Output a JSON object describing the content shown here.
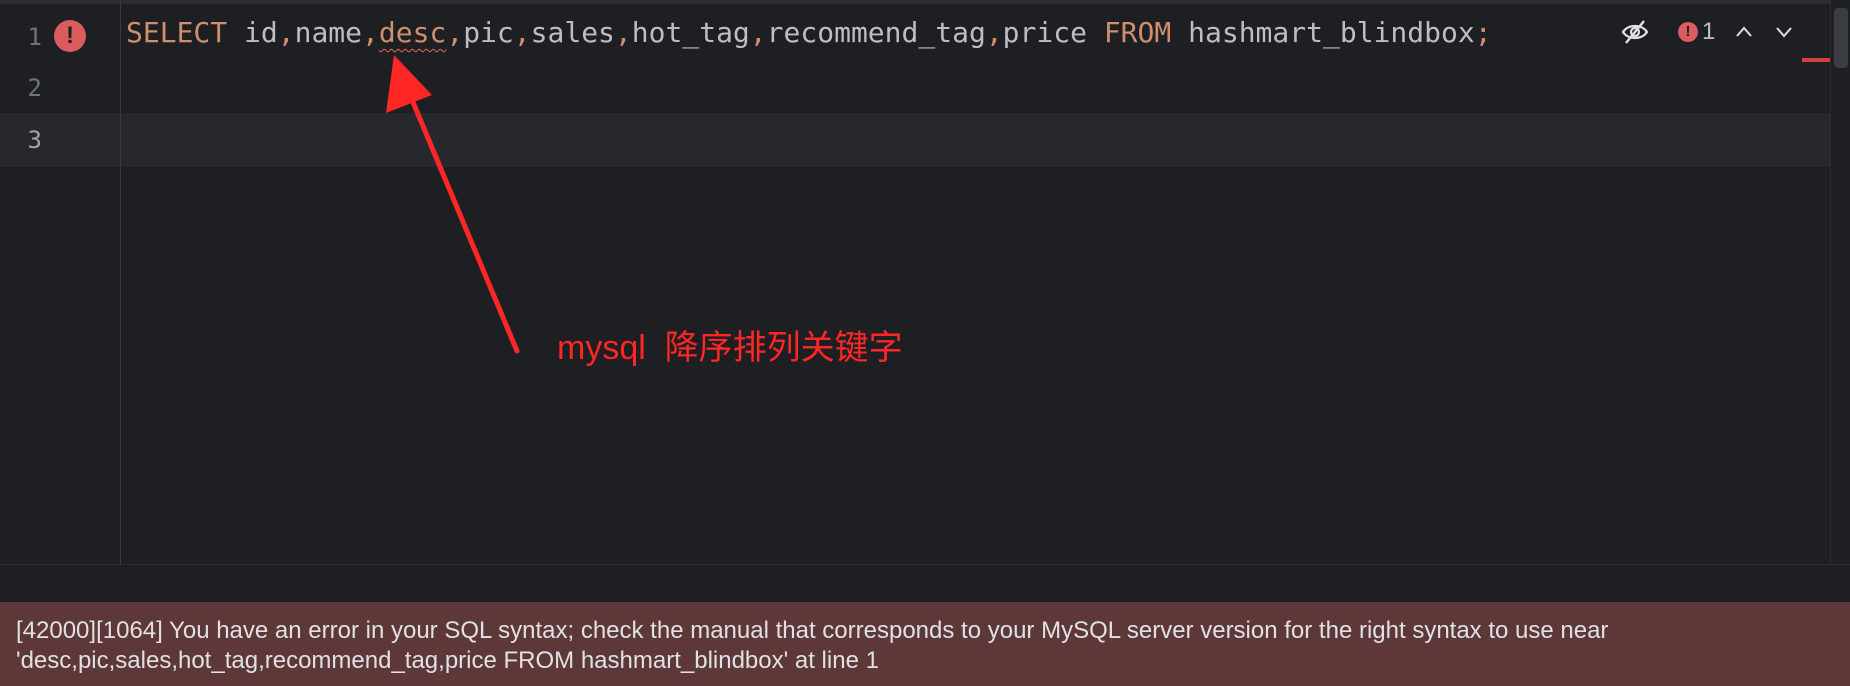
{
  "editor": {
    "line_numbers": [
      "1",
      "2",
      "3"
    ],
    "code": {
      "select_kw": "SELECT",
      "col_id": "id",
      "col_name": "name",
      "col_desc": "desc",
      "col_pic": "pic",
      "col_sales": "sales",
      "col_hot_tag": "hot_tag",
      "col_recommend_tag": "recommend_tag",
      "col_price": "price",
      "from_kw": "FROM",
      "table": "hashmart_blindbox",
      "comma": ",",
      "semicolon": ";"
    },
    "gutter_error_icon": "!"
  },
  "inspection": {
    "error_icon": "!",
    "error_count": "1",
    "icons": [
      "eye-slash-icon",
      "error-icon",
      "chevron-up-icon",
      "chevron-down-icon"
    ]
  },
  "annotation": {
    "text": "mysql  降序排列关键字",
    "color": "#ff2626"
  },
  "error_panel": {
    "message": "[42000][1064] You have an error in your SQL syntax; check the manual that corresponds to your MySQL server version for the right syntax to use near 'desc,pic,sales,hot_tag,recommend_tag,price FROM hashmart_blindbox' at line 1"
  },
  "colors": {
    "background": "#1e1f22",
    "keyword": "#cf8e6d",
    "error_panel_bg": "#5e3838",
    "error_red": "#db5c5c"
  }
}
